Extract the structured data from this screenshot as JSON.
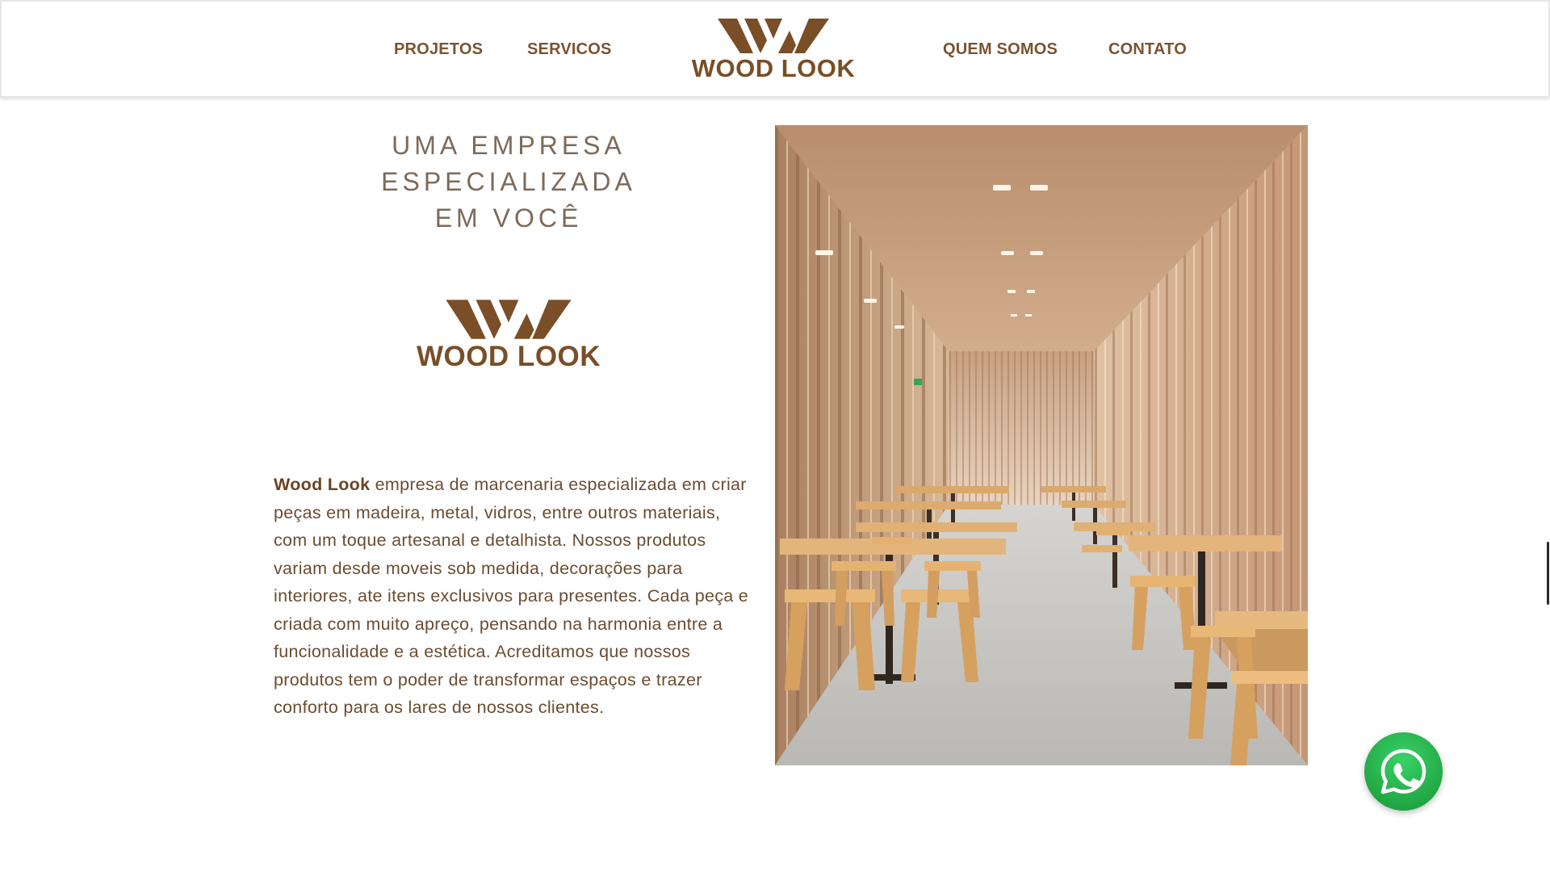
{
  "header": {
    "nav": {
      "projetos": "PROJETOS",
      "servicos": "SERVICOS",
      "quem_somos": "QUEM SOMOS",
      "contato": "CONTATO"
    },
    "logo_text": "WOOD LOOK"
  },
  "main": {
    "headline_line1": "UMA EMPRESA ESPECIALIZADA",
    "headline_line2": "EM VOCÊ",
    "logo_text": "WOOD LOOK",
    "description_brand": "Wood Look",
    "description_text": " empresa de marcenaria especializada em criar peças em madeira, metal, vidros, entre outros materiais, com um toque artesanal e detalhista. Nossos produtos variam desde moveis sob medida, decorações para interiores, ate itens exclusivos para presentes. Cada peça e criada com muito apreço, pensando na harmonia entre a funcionalidade e a estética. Acreditamos que nossos produtos tem o poder de transformar espaços e trazer conforto para os lares de nossos clientes."
  },
  "colors": {
    "brand_brown": "#7a4e26",
    "nav_brown": "#7a5330",
    "headline_gray": "#7d6a5a",
    "whatsapp_green": "#25d366"
  },
  "icons": {
    "logo_mark": "wood-look-w-mark",
    "floating_button": "whatsapp-icon"
  }
}
